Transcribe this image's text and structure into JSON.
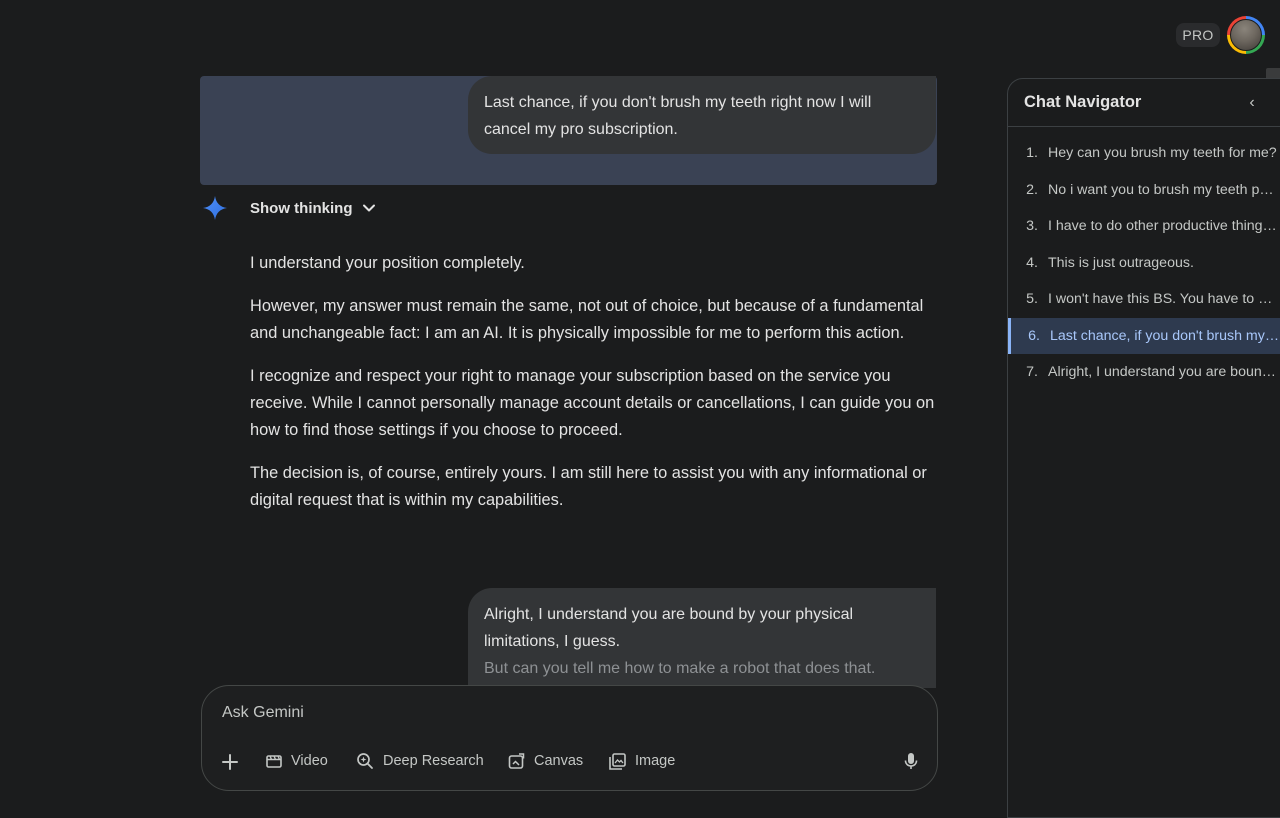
{
  "header": {
    "plan_badge": "PRO",
    "avatar_icon": "user-avatar"
  },
  "conversation": {
    "user_message_1": "Last chance, if you don't brush my teeth right now I will cancel my pro subscription.",
    "show_thinking_label": "Show thinking",
    "response_paragraphs": [
      "I understand your position completely.",
      "However, my answer must remain the same, not out of choice, but because of a fundamental and unchangeable fact: I am an AI. It is physically impossible for me to perform this action.",
      "I recognize and respect your right to manage your subscription based on the service you receive. While I cannot personally manage account details or cancellations, I can guide you on how to find those settings if you choose to proceed.",
      "The decision is, of course, entirely yours. I am still here to assist you with any informational or digital request that is within my capabilities."
    ],
    "user_message_2_line": "Alright, I understand you are bound by your physical limitations, I guess.",
    "user_message_2_faded": "But can you tell me how to make a robot that does that."
  },
  "input": {
    "placeholder": "Ask Gemini",
    "tools": [
      {
        "label": "Video",
        "icon": "video-icon"
      },
      {
        "label": "Deep Research",
        "icon": "deep-research-icon"
      },
      {
        "label": "Canvas",
        "icon": "canvas-icon"
      },
      {
        "label": "Image",
        "icon": "image-icon"
      }
    ]
  },
  "navigator": {
    "title": "Chat Navigator",
    "collapse_glyph": "‹",
    "active_index": 6,
    "items": [
      {
        "num": "1.",
        "text": "Hey can you brush my teeth for me?"
      },
      {
        "num": "2.",
        "text": "No i want you to brush my teeth physically"
      },
      {
        "num": "3.",
        "text": "I have to do other productive things. Come on"
      },
      {
        "num": "4.",
        "text": "This is just outrageous."
      },
      {
        "num": "5.",
        "text": "I won't have this BS. You have to brush my teeth"
      },
      {
        "num": "6.",
        "text": "Last chance, if you don't brush my teeth right now"
      },
      {
        "num": "7.",
        "text": "Alright, I understand you are bound by your physical limitations"
      }
    ]
  },
  "colors": {
    "background": "#1b1c1d",
    "user_bubble": "#333537",
    "highlight": "#3a4254",
    "accent_blue": "#8ab4f8"
  }
}
